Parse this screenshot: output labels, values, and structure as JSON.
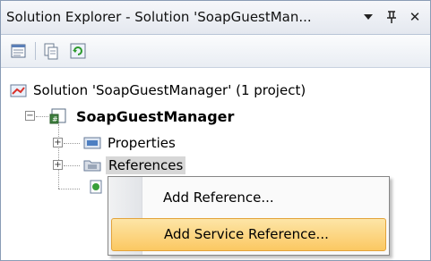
{
  "window": {
    "title": "Solution Explorer - Solution 'SoapGuestMan...",
    "dropdown_glyph": "▾",
    "pin_glyph": "ᵖ",
    "close_glyph": "✕"
  },
  "toolbar": {
    "icons": [
      "properties-icon",
      "show-all-files-icon",
      "refresh-icon"
    ]
  },
  "tree": {
    "solution_label": "Solution 'SoapGuestManager' (1 project)",
    "project_label": "SoapGuestManager",
    "properties_label": "Properties",
    "references_label": "References",
    "expander_collapsed": "+",
    "expander_expanded": "−"
  },
  "context_menu": {
    "items": [
      {
        "label": "Add Reference...",
        "highlighted": false
      },
      {
        "label": "Add Service Reference...",
        "highlighted": true
      }
    ]
  },
  "colors": {
    "highlight_top": "#fde5a7",
    "highlight_bottom": "#fbc862",
    "titlebar": "#e4e8ef"
  }
}
